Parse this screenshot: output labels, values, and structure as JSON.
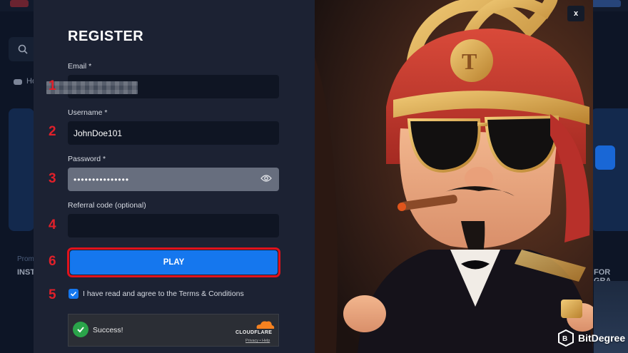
{
  "background": {
    "nav_item": "Ho",
    "promo_tag": "Prom",
    "promo_title": "INSTA",
    "right_title": "FOR GRA"
  },
  "modal": {
    "title": "REGISTER",
    "close_label": "x",
    "email": {
      "label": "Email *",
      "value": ""
    },
    "username": {
      "label": "Username *",
      "value": "JohnDoe101"
    },
    "password": {
      "label": "Password *",
      "value": "•••••••••••••••"
    },
    "referral": {
      "label": "Referral code (optional)",
      "value": ""
    },
    "play_label": "PLAY",
    "terms_label": "I have read and agree to the Terms & Conditions",
    "terms_checked": true,
    "captcha": {
      "status": "Success!",
      "brand": "CLOUDFLARE",
      "links": "Privacy • Help"
    }
  },
  "steps": [
    "1",
    "2",
    "3",
    "4",
    "6",
    "5"
  ],
  "watermark": "BitDegree",
  "colors": {
    "accent": "#1577ee",
    "highlight": "#e0121c",
    "modal_bg": "#1c2233"
  }
}
